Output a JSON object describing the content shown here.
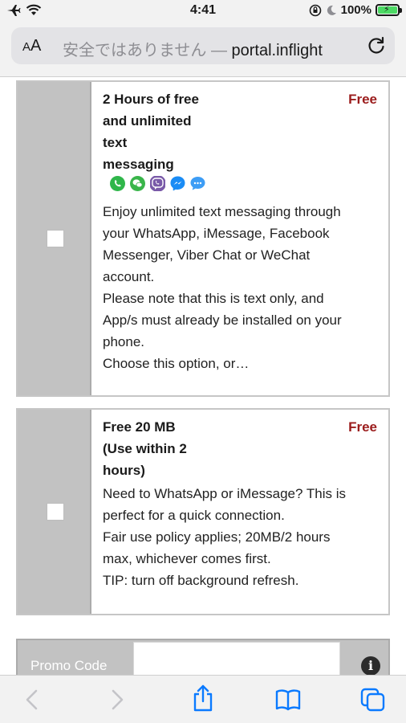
{
  "status_bar": {
    "time": "4:41",
    "battery_text": "100%",
    "battery_level": 1.0,
    "icons": [
      "airplane-icon",
      "wifi-icon",
      "screen-lock-rotation-icon",
      "moon-icon",
      "battery-charging-icon"
    ]
  },
  "address_bar": {
    "text_size_label_small": "A",
    "text_size_label_large": "A",
    "security_warning": "安全ではありません — ",
    "host": "portal.inflight"
  },
  "plans": [
    {
      "title_lines": [
        "2 Hours of free",
        "and unlimited",
        "text",
        "messaging"
      ],
      "price": "Free",
      "app_icons": [
        "whatsapp-icon",
        "wechat-icon",
        "viber-icon",
        "messenger-icon",
        "imessage-icon"
      ],
      "description_lines": [
        "Enjoy unlimited text messaging through",
        "your WhatsApp, iMessage, Facebook",
        "Messenger, Viber Chat or WeChat",
        "account.",
        "Please note that this is text only, and",
        "App/s must already be installed on your",
        "phone.",
        "Choose this option, or…"
      ],
      "selected": false
    },
    {
      "title_lines": [
        "Free 20 MB",
        "(Use within 2",
        "hours)"
      ],
      "price": "Free",
      "description_lines": [
        "Need to WhatsApp or iMessage? This is",
        "perfect for a quick connection.",
        "Fair use policy applies; 20MB/2 hours",
        "max, whichever comes first.",
        "TIP: turn off background refresh."
      ],
      "selected": false
    }
  ],
  "promo": {
    "label": "Promo Code",
    "value": ""
  },
  "colors": {
    "price": "#9b1c1c",
    "card_side": "#c2c2c2",
    "chrome": "#f2f2f2",
    "accent": "#0a7aff",
    "battery": "#4cd964"
  }
}
